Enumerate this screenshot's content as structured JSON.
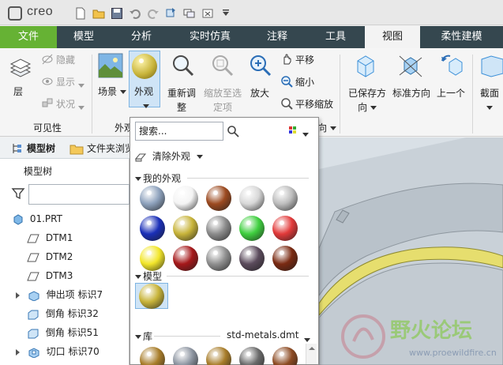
{
  "app": {
    "logo_text": "creo"
  },
  "tabs": [
    "文件",
    "模型",
    "分析",
    "实时仿真",
    "注释",
    "工具",
    "视图",
    "柔性建模"
  ],
  "active_tab": "视图",
  "colors": {
    "file_tab": "#66b234",
    "tabbar": "#35474f",
    "accent": "#3b8fd8"
  },
  "ribbon": {
    "layer": "层",
    "hide": "隐藏",
    "show": "显示",
    "status": "状况",
    "scene": "场景",
    "appearance": "外观",
    "reorient": [
      "重新调",
      "整"
    ],
    "zoom_to_selected": [
      "缩放至选",
      "定项"
    ],
    "zoom_in": "放大",
    "pan": "平移",
    "zoom_out": "缩小",
    "pan_zoom": "平移缩放",
    "saved_orient": [
      "已保存方",
      "向"
    ],
    "standard_orient": "标准方向",
    "previous": "上一个",
    "section": "截面",
    "groups": {
      "visibility": "可见性",
      "appearance_group": "外观",
      "orientation_suffix": "向"
    }
  },
  "left_panel": {
    "tabs": [
      "模型树",
      "文件夹浏览"
    ],
    "header": "模型树",
    "items": [
      {
        "label": "01.PRT",
        "kind": "part"
      },
      {
        "label": "DTM1",
        "kind": "plane"
      },
      {
        "label": "DTM2",
        "kind": "plane"
      },
      {
        "label": "DTM3",
        "kind": "plane"
      },
      {
        "label": "伸出项 标识7",
        "kind": "feature"
      },
      {
        "label": "倒角 标识32",
        "kind": "feature"
      },
      {
        "label": "倒角 标识51",
        "kind": "feature"
      },
      {
        "label": "切口 标识70",
        "kind": "feature"
      }
    ]
  },
  "popup": {
    "search_placeholder": "搜索...",
    "clear": "清除外观",
    "my_appearances": "我的外观",
    "model": "模型",
    "library": "库",
    "library_file": "std-metals.dmt",
    "my_swatches": [
      [
        "#8ea2bd",
        "#f4f4f4",
        "#9c4a20",
        "#d8d8d8",
        "#bdbdbd"
      ],
      [
        "#1a2fb8",
        "#c8b43a",
        "#8c8c8c",
        "#3fcf3f",
        "#e23a3a"
      ],
      [
        "#f2e62a",
        "#a5181a",
        "#909090",
        "#5b4b5c",
        "#7a2a12"
      ]
    ],
    "model_swatch": "#c8b43a",
    "library_swatches": [
      "#a87d2a",
      "#8c94a0",
      "#a87d2a",
      "#6a6a6a",
      "#8c4a22"
    ]
  },
  "watermark": {
    "text": "野火论坛",
    "url": "www.proewildfire.cn"
  }
}
